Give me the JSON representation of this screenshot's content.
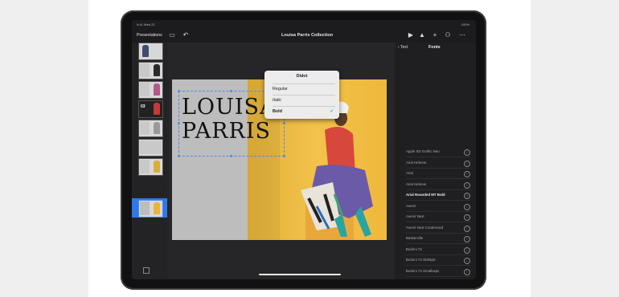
{
  "status": {
    "time": "9:41 Wed 22",
    "battery": "100%"
  },
  "toolbar": {
    "presentations": "Presentations",
    "title": "Louisa Parris Collection",
    "icons": [
      "slide-list-icon",
      "undo-icon",
      "play-icon",
      "image-icon",
      "add-icon",
      "share-icon",
      "more-icon"
    ]
  },
  "slide": {
    "line1": "LOUISA",
    "line2": "PARRIS"
  },
  "panel": {
    "back": "Text",
    "title": "Fonts",
    "fonts": [
      "Apple SD Gothic Neo",
      "Arial Hebrew",
      "Arial",
      "Arial Hebrew",
      "Arial Rounded MT Bold",
      "Avenir",
      "Avenir Next",
      "Avenir Next Condensed",
      "Baskerville",
      "Bodoni 72",
      "Bodoni 72 Oldstyle",
      "Bodoni 72 Smallcaps",
      "Bradley Hand"
    ]
  },
  "dropdown": {
    "title": "Didot",
    "items": [
      "Regular",
      "Italic",
      "Bold"
    ],
    "selected": "Bold"
  }
}
